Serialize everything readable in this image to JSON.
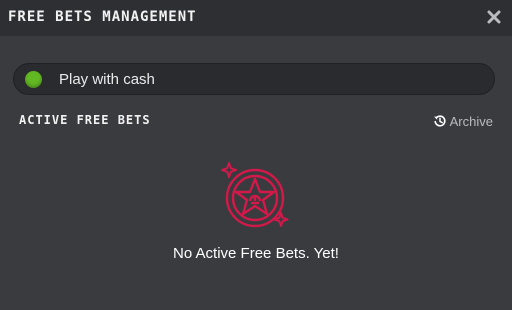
{
  "modal": {
    "title": "FREE BETS MANAGEMENT",
    "close_icon": "close-icon"
  },
  "cash_toggle": {
    "label": "Play with cash",
    "indicator_color": "#62b823",
    "active": true
  },
  "active_free_bets": {
    "title": "ACTIVE FREE BETS",
    "archive_label": "Archive",
    "archive_icon": "history-icon"
  },
  "empty_state": {
    "icon": "star-badge-icon",
    "message": "No Active Free Bets. Yet!",
    "accent_color": "#d2194a"
  }
}
